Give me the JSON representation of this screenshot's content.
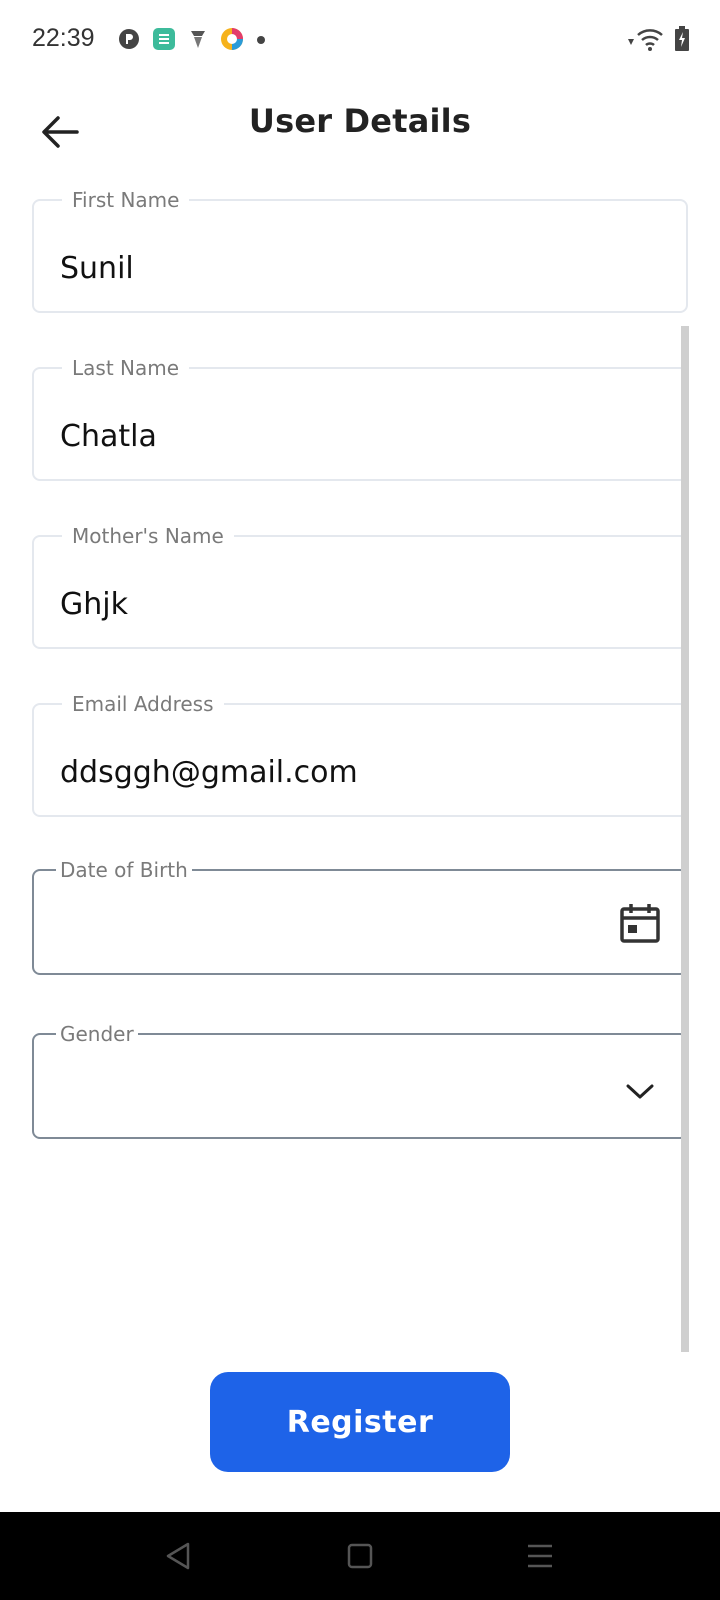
{
  "status_bar": {
    "time": "22:39",
    "left_icons": [
      "circle-p-icon",
      "app-green-icon",
      "gem-icon",
      "colorful-app-icon",
      "dot-icon"
    ],
    "right_icons": [
      "wifi-icon",
      "battery-charging-icon"
    ]
  },
  "header": {
    "title": "User Details",
    "back_icon": "arrow-left-icon"
  },
  "form": {
    "first_name": {
      "label": "First Name",
      "value": "Sunil"
    },
    "last_name": {
      "label": "Last Name",
      "value": "Chatla"
    },
    "mothers_name": {
      "label": "Mother's Name",
      "value": "Ghjk"
    },
    "email": {
      "label": "Email Address",
      "value": "ddsggh@gmail.com"
    },
    "dob": {
      "label": "Date of Birth",
      "value": "",
      "icon": "calendar-icon"
    },
    "gender": {
      "label": "Gender",
      "value": "",
      "icon": "chevron-down-icon"
    }
  },
  "register_label": "Register",
  "colors": {
    "accent": "#1e63e8",
    "field_border": "#e4e8ee",
    "field_border_active": "#7f8a96",
    "label_text": "#7a7a7a"
  },
  "nav_bar": {
    "icons": [
      "back-triangle-icon",
      "home-square-icon",
      "menu-lines-icon"
    ]
  }
}
